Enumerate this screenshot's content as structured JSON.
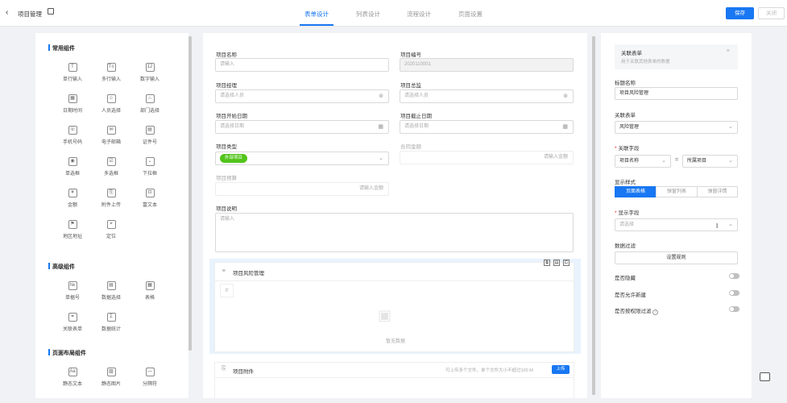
{
  "header": {
    "back_glyph": "‹",
    "title": "项目管理",
    "tabs": [
      {
        "label": "表单设计",
        "active": true
      },
      {
        "label": "列表设计",
        "active": false
      },
      {
        "label": "流程设计",
        "active": false
      },
      {
        "label": "页面设置",
        "active": false
      }
    ],
    "save_label": "保存",
    "close_label": "关闭"
  },
  "components": {
    "common_title": "常用组件",
    "common": [
      {
        "label": "单行输入",
        "icon": "T"
      },
      {
        "label": "多行输入",
        "icon": "T≡"
      },
      {
        "label": "数字输入",
        "icon": "12"
      },
      {
        "label": "日期时间",
        "icon": "▦"
      },
      {
        "label": "人员选择",
        "icon": "☺"
      },
      {
        "label": "部门选择",
        "icon": "⌂"
      },
      {
        "label": "手机号码",
        "icon": "☏"
      },
      {
        "label": "电子邮箱",
        "icon": "✉"
      },
      {
        "label": "证件号",
        "icon": "▤"
      },
      {
        "label": "单选框",
        "icon": "◉"
      },
      {
        "label": "多选框",
        "icon": "☑"
      },
      {
        "label": "下拉框",
        "icon": "⌄"
      },
      {
        "label": "金额",
        "icon": "¥"
      },
      {
        "label": "附件上传",
        "icon": "⎘"
      },
      {
        "label": "富文本",
        "icon": "⊡"
      },
      {
        "label": "地区地址",
        "icon": "⚑"
      },
      {
        "label": "定位",
        "icon": "⌖"
      }
    ],
    "advanced_title": "高级组件",
    "advanced": [
      {
        "label": "单据号",
        "icon": "№"
      },
      {
        "label": "数据选择",
        "icon": "▤"
      },
      {
        "label": "表格",
        "icon": "▦"
      },
      {
        "label": "关联表单",
        "icon": "⚭"
      },
      {
        "label": "数据统计",
        "icon": "Σ"
      }
    ],
    "layout_title": "页面布局组件",
    "layout": [
      {
        "label": "静态文本",
        "icon": "Aa"
      },
      {
        "label": "静态图片",
        "icon": "▨"
      },
      {
        "label": "分隔符",
        "icon": "—"
      }
    ]
  },
  "form": {
    "project_name": {
      "label": "项目名称",
      "placeholder": "请输入"
    },
    "project_no": {
      "label": "项目编号",
      "value": "2020110001"
    },
    "manager": {
      "label": "项目经理",
      "placeholder": "请选择人员"
    },
    "director": {
      "label": "项目总监",
      "placeholder": "请选择人员"
    },
    "start_date": {
      "label": "项目开始日期",
      "placeholder": "请选择日期"
    },
    "end_date": {
      "label": "项目截止日期",
      "placeholder": "请选择日期"
    },
    "type": {
      "label": "项目类型",
      "tag": "外部项目"
    },
    "contract": {
      "label": "合同金额",
      "placeholder": "请输入金额"
    },
    "budget": {
      "label": "项目预算",
      "placeholder": "请输入金额"
    },
    "desc": {
      "label": "项目说明",
      "placeholder": "请输入"
    },
    "risk": {
      "title": "项目风险管理",
      "hash": "#",
      "empty": "暂无数据"
    },
    "attachment": {
      "title": "项目附件",
      "hint": "可上传多个文件，单个文件大小不超过100 M",
      "upload": "上传"
    }
  },
  "props": {
    "link_title": "关联表单",
    "link_desc": "用于关联其他表单的数据",
    "title_label": "标题名称",
    "title_value": "项目风险管理",
    "link_form_label": "关联表单",
    "link_form_value": "风险管理",
    "link_field_label": "关联字段",
    "field_left": "项目名称",
    "equals": "=",
    "field_right": "所属项目",
    "display_style_label": "显示样式",
    "styles": [
      {
        "label": "页面表格",
        "active": true
      },
      {
        "label": "弹窗列表",
        "active": false
      },
      {
        "label": "弹窗详情",
        "active": false
      }
    ],
    "display_field_label": "显示字段",
    "display_field_placeholder": "请选择",
    "filter_label": "数据过滤",
    "filter_button": "设置规则",
    "hidden_label": "是否隐藏",
    "allow_new_label": "是否允许新建",
    "permission_filter_label": "是否按权限过滤",
    "help_glyph": "?"
  },
  "colors": {
    "primary": "#1877f2",
    "tag": "#52c41a",
    "selected": "#e8f3fe"
  }
}
